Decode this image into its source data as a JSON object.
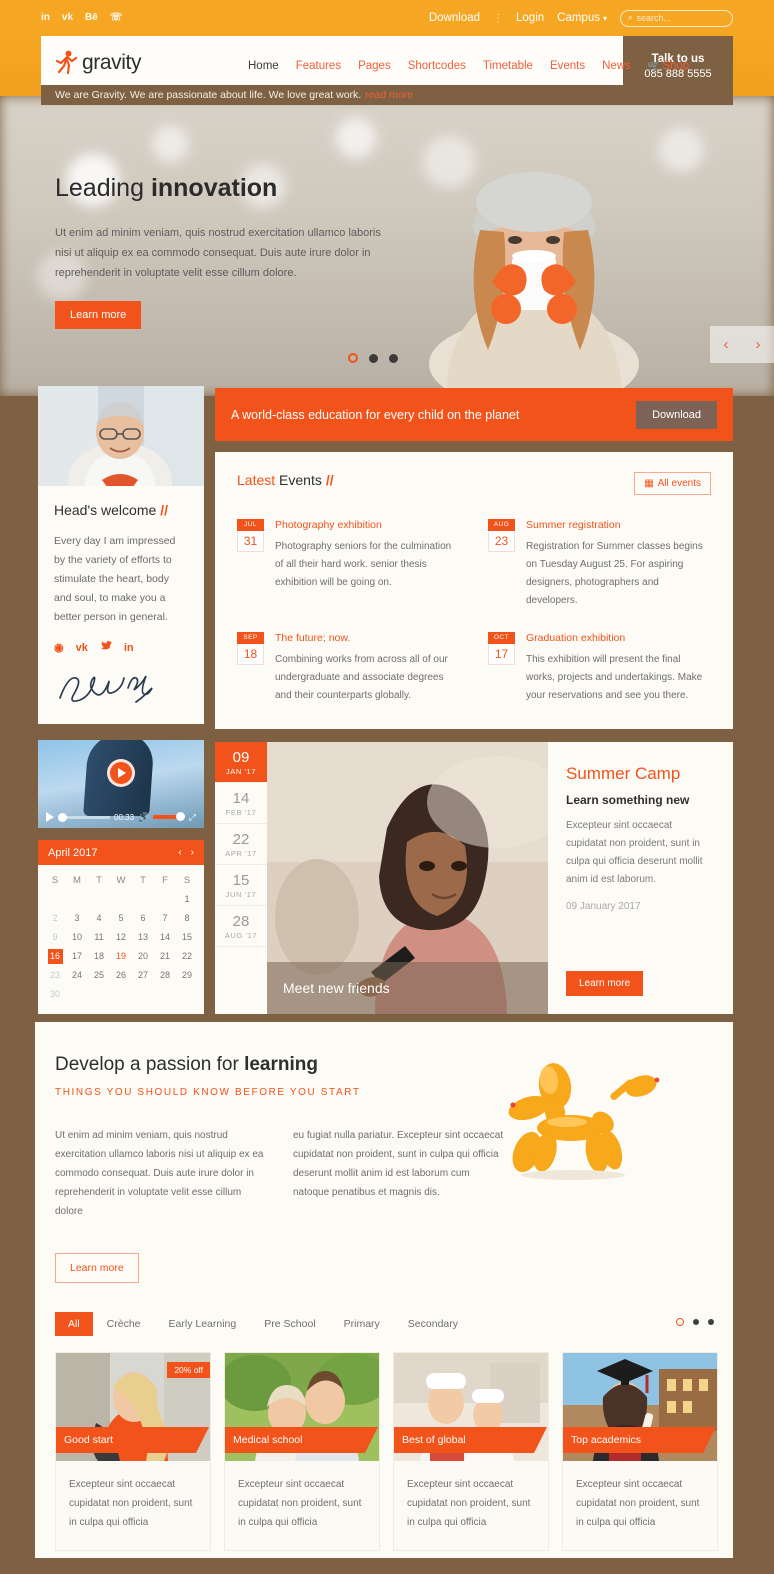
{
  "topbar": {
    "social": [
      {
        "name": "linkedin-icon",
        "glyph": "in"
      },
      {
        "name": "vk-icon",
        "glyph": "vk"
      },
      {
        "name": "behance-icon",
        "glyph": "Bē"
      },
      {
        "name": "whatsapp-icon",
        "glyph": "☏"
      }
    ],
    "download": "Download",
    "separator": "⋮",
    "login": "Login",
    "campus": "Campus",
    "search_placeholder": "search..."
  },
  "header": {
    "logo_text": "gravity",
    "nav": [
      {
        "label": "Home",
        "active": true
      },
      {
        "label": "Features",
        "active": false
      },
      {
        "label": "Pages",
        "active": false
      },
      {
        "label": "Shortcodes",
        "active": false
      },
      {
        "label": "Timetable",
        "active": false
      },
      {
        "label": "Events",
        "active": false
      },
      {
        "label": "News",
        "active": false
      },
      {
        "label": "Shop",
        "active": false,
        "icon": "cart-icon"
      }
    ],
    "talk_title": "Talk to us",
    "talk_phone": "085 888 5555"
  },
  "tagline": {
    "text": "We are Gravity. We are passionate about life. We love great work.",
    "read_more": "read more"
  },
  "hero": {
    "title_light": "Leading ",
    "title_bold": "innovation",
    "paragraph": "Ut enim ad minim veniam, quis nostrud exercitation ullamco laboris nisi ut aliquip ex ea commodo consequat. Duis aute irure dolor in reprehenderit in voluptate velit esse cillum dolore.",
    "button": "Learn more",
    "prev": "‹",
    "next": "›",
    "dots": 3,
    "active_dot": 0
  },
  "welcome": {
    "title": "Head's welcome",
    "slash": "//",
    "paragraph": "Every day I am impressed by the variety of efforts to stimulate the heart, body and soul, to make you a better person in general.",
    "social": [
      {
        "name": "dribbble-icon",
        "glyph": "◉"
      },
      {
        "name": "vk-icon",
        "glyph": "vk"
      },
      {
        "name": "twitter-icon",
        "glyph": "🐦"
      },
      {
        "name": "linkedin-icon",
        "glyph": "in"
      }
    ],
    "signature_name": "Jena Nichosky"
  },
  "video": {
    "time": "00:33",
    "play_label": "play",
    "volume_label": "volume",
    "fullscreen_label": "fullscreen"
  },
  "calendar": {
    "title": "April 2017",
    "prev": "‹",
    "next": "›",
    "dow": [
      "S",
      "M",
      "T",
      "W",
      "T",
      "F",
      "S"
    ],
    "weeks": [
      [
        {
          "d": "",
          "t": "blank"
        },
        {
          "d": "",
          "t": "blank"
        },
        {
          "d": "",
          "t": "blank"
        },
        {
          "d": "",
          "t": "blank"
        },
        {
          "d": "",
          "t": "blank"
        },
        {
          "d": "",
          "t": "blank"
        },
        {
          "d": "1",
          "t": "normal"
        }
      ],
      [
        {
          "d": "2",
          "t": "muted"
        },
        {
          "d": "3",
          "t": "normal"
        },
        {
          "d": "4",
          "t": "normal"
        },
        {
          "d": "5",
          "t": "normal"
        },
        {
          "d": "6",
          "t": "normal"
        },
        {
          "d": "7",
          "t": "normal"
        },
        {
          "d": "8",
          "t": "normal"
        }
      ],
      [
        {
          "d": "9",
          "t": "muted"
        },
        {
          "d": "10",
          "t": "normal"
        },
        {
          "d": "11",
          "t": "normal"
        },
        {
          "d": "12",
          "t": "normal"
        },
        {
          "d": "13",
          "t": "normal"
        },
        {
          "d": "14",
          "t": "normal"
        },
        {
          "d": "15",
          "t": "normal"
        }
      ],
      [
        {
          "d": "16",
          "t": "today"
        },
        {
          "d": "17",
          "t": "normal"
        },
        {
          "d": "18",
          "t": "normal"
        },
        {
          "d": "19",
          "t": "hl"
        },
        {
          "d": "20",
          "t": "normal"
        },
        {
          "d": "21",
          "t": "normal"
        },
        {
          "d": "22",
          "t": "normal"
        }
      ],
      [
        {
          "d": "23",
          "t": "muted"
        },
        {
          "d": "24",
          "t": "normal"
        },
        {
          "d": "25",
          "t": "normal"
        },
        {
          "d": "26",
          "t": "normal"
        },
        {
          "d": "27",
          "t": "normal"
        },
        {
          "d": "28",
          "t": "normal"
        },
        {
          "d": "29",
          "t": "normal"
        }
      ],
      [
        {
          "d": "30",
          "t": "muted"
        },
        {
          "d": "",
          "t": "blank"
        },
        {
          "d": "",
          "t": "blank"
        },
        {
          "d": "",
          "t": "blank"
        },
        {
          "d": "",
          "t": "blank"
        },
        {
          "d": "",
          "t": "blank"
        },
        {
          "d": "",
          "t": "blank"
        }
      ]
    ]
  },
  "promo": {
    "text": "A world-class education for every child on the planet",
    "button": "Download"
  },
  "events": {
    "title_orange": "Latest ",
    "title_dark": "Events",
    "slash": "//",
    "all_events": "All events",
    "items": [
      {
        "month": "JUL",
        "day": "31",
        "name": "Photography exhibition",
        "desc": "Photography seniors for the culmination of all their hard work. senior thesis exhibition will be going on."
      },
      {
        "month": "AUG",
        "day": "23",
        "name": "Summer registration",
        "desc": "Registration for Summer classes begins on Tuesday August 25. For aspiring designers, photographers and developers."
      },
      {
        "month": "SEP",
        "day": "18",
        "name": "The future; now.",
        "desc": "Combining works from across all of our undergraduate and associate degrees and their counterparts globally."
      },
      {
        "month": "OCT",
        "day": "17",
        "name": "Graduation exhibition",
        "desc": "This exhibition will present the final works, projects and undertakings. Make your reservations and see you there."
      }
    ]
  },
  "camp": {
    "dates": [
      {
        "n": "09",
        "m": "JAN '17",
        "active": true
      },
      {
        "n": "14",
        "m": "FEB '17",
        "active": false
      },
      {
        "n": "22",
        "m": "APR '17",
        "active": false
      },
      {
        "n": "15",
        "m": "JUN '17",
        "active": false
      },
      {
        "n": "28",
        "m": "AUG '17",
        "active": false
      }
    ],
    "caption": "Meet new friends",
    "heading": "Summer Camp",
    "subheading": "Learn something new",
    "paragraph": "Excepteur sint occaecat cupidatat non proident, sunt in culpa qui officia deserunt mollit anim id est laborum.",
    "date": "09 January 2017",
    "button": "Learn more"
  },
  "passion": {
    "title_light": "Develop a passion for ",
    "title_bold": "learning",
    "kicker": "THINGS YOU SHOULD KNOW BEFORE YOU START",
    "col1": "Ut enim ad minim veniam, quis nostrud exercitation ullamco laboris nisi ut aliquip ex ea commodo consequat. Duis aute irure dolor in reprehenderit in voluptate velit esse cillum dolore",
    "col2": "eu fugiat nulla pariatur. Excepteur sint occaecat cupidatat non proident, sunt in culpa qui officia deserunt mollit anim id est laborum cum natoque penatibus et magnis dis.",
    "button": "Learn more"
  },
  "tabs": {
    "items": [
      {
        "label": "All",
        "active": true
      },
      {
        "label": "Crèche",
        "active": false
      },
      {
        "label": "Early Learning",
        "active": false
      },
      {
        "label": "Pre School",
        "active": false
      },
      {
        "label": "Primary",
        "active": false
      },
      {
        "label": "Secondary",
        "active": false
      }
    ],
    "dots": 3,
    "active_dot": 0
  },
  "cards": [
    {
      "ribbon": "Good start",
      "badge": "20% off",
      "text": "Excepteur sint occaecat cupidatat non proident, sunt in culpa qui officia"
    },
    {
      "ribbon": "Medical school",
      "badge": "",
      "text": "Excepteur sint occaecat cupidatat non proident, sunt in culpa qui officia"
    },
    {
      "ribbon": "Best of global",
      "badge": "",
      "text": "Excepteur sint occaecat cupidatat non proident, sunt in culpa qui officia"
    },
    {
      "ribbon": "Top academics",
      "badge": "",
      "text": "Excepteur sint occaecat cupidatat non proident, sunt in culpa qui officia"
    }
  ],
  "colors": {
    "orange": "#f2531b",
    "amber": "#f5a623",
    "brown": "#7d6142",
    "cream": "#fdfbf6"
  }
}
